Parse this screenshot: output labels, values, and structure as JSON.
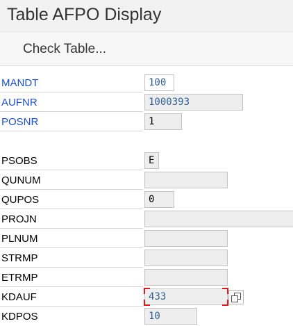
{
  "window": {
    "title": "Table AFPO Display"
  },
  "toolbar": {
    "check_table_label": "Check Table..."
  },
  "fields": [
    {
      "label": "MANDT",
      "value": "100"
    },
    {
      "label": "AUFNR",
      "value": "1000393"
    },
    {
      "label": "POSNR",
      "value": "1"
    },
    {
      "label": "PSOBS",
      "value": "E"
    },
    {
      "label": "QUNUM",
      "value": ""
    },
    {
      "label": "QUPOS",
      "value": "0"
    },
    {
      "label": "PROJN",
      "value": ""
    },
    {
      "label": "PLNUM",
      "value": ""
    },
    {
      "label": "STRMP",
      "value": ""
    },
    {
      "label": "ETRMP",
      "value": ""
    },
    {
      "label": "KDAUF",
      "value": "433"
    },
    {
      "label": "KDPOS",
      "value": "10"
    }
  ],
  "icons": {
    "value_help": "value-help-icon"
  },
  "colors": {
    "key_field_label": "#1a4fd6",
    "value_text_blue": "#2f5f95",
    "focus_corner": "#e0191f",
    "readonly_field_bg": "#eeeeee"
  }
}
